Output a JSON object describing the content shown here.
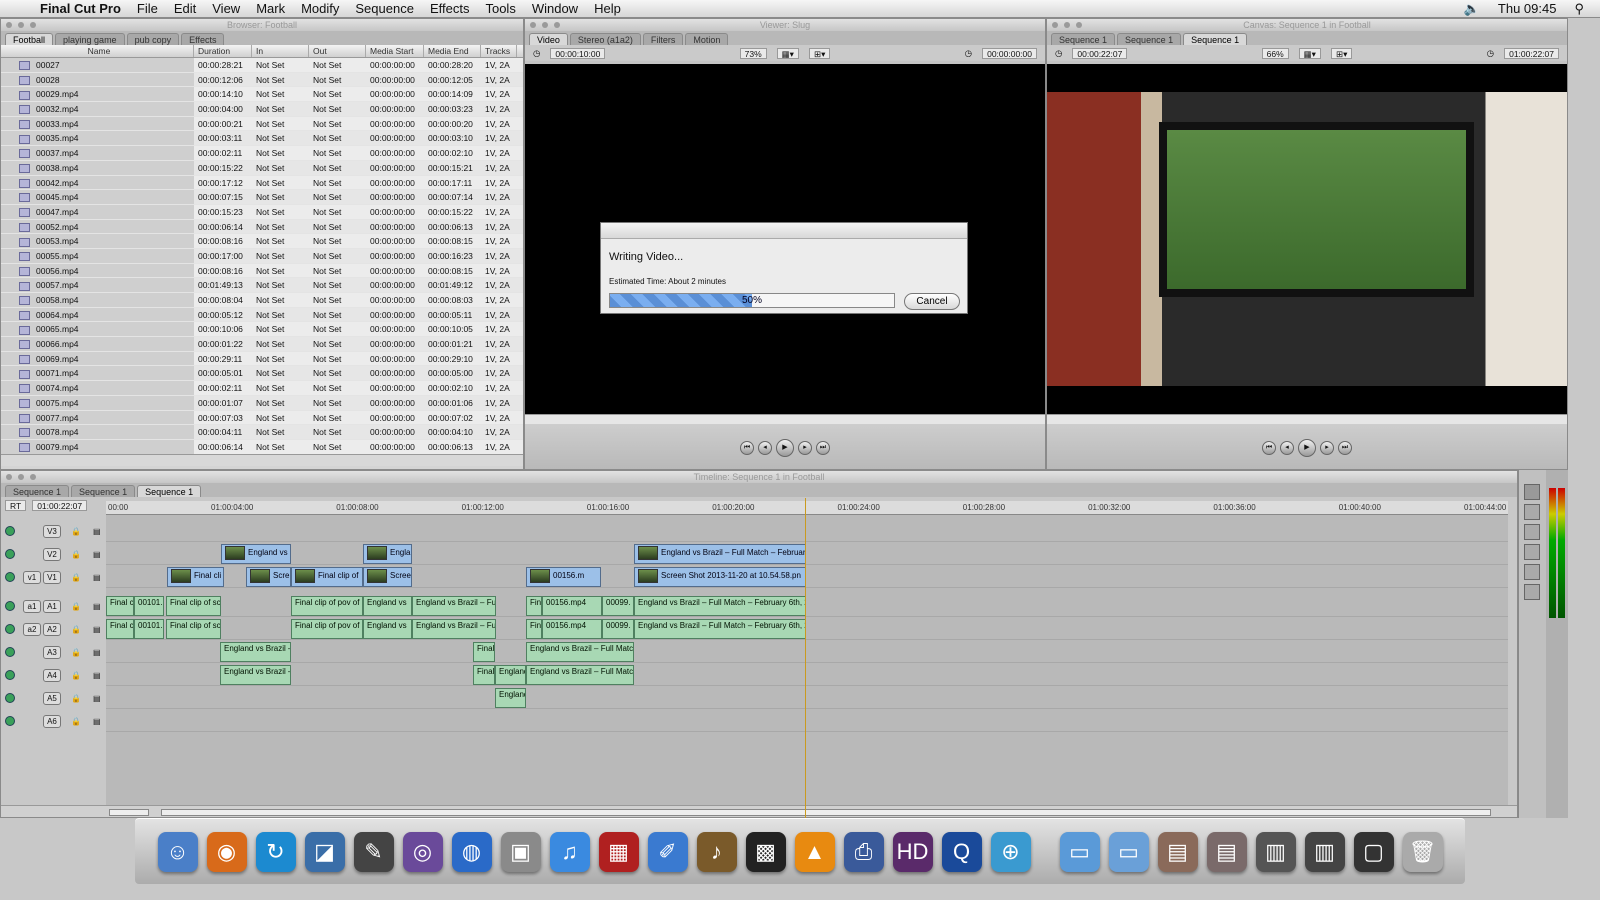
{
  "menubar": {
    "app": "Final Cut Pro",
    "items": [
      "File",
      "Edit",
      "View",
      "Mark",
      "Modify",
      "Sequence",
      "Effects",
      "Tools",
      "Window",
      "Help"
    ],
    "clock": "Thu 09:45"
  },
  "browser": {
    "title": "Browser: Football",
    "tabs": [
      "Football",
      "playing game",
      "pub copy",
      "Effects"
    ],
    "columns": [
      "Name",
      "Duration",
      "In",
      "Out",
      "Media Start",
      "Media End",
      "Tracks"
    ],
    "rows": [
      [
        "00027",
        "00:00:28:21",
        "Not Set",
        "Not Set",
        "00:00:00:00",
        "00:00:28:20",
        "1V, 2A"
      ],
      [
        "00028",
        "00:00:12:06",
        "Not Set",
        "Not Set",
        "00:00:00:00",
        "00:00:12:05",
        "1V, 2A"
      ],
      [
        "00029.mp4",
        "00:00:14:10",
        "Not Set",
        "Not Set",
        "00:00:00:00",
        "00:00:14:09",
        "1V, 2A"
      ],
      [
        "00032.mp4",
        "00:00:04:00",
        "Not Set",
        "Not Set",
        "00:00:00:00",
        "00:00:03:23",
        "1V, 2A"
      ],
      [
        "00033.mp4",
        "00:00:00:21",
        "Not Set",
        "Not Set",
        "00:00:00:00",
        "00:00:00:20",
        "1V, 2A"
      ],
      [
        "00035.mp4",
        "00:00:03:11",
        "Not Set",
        "Not Set",
        "00:00:00:00",
        "00:00:03:10",
        "1V, 2A"
      ],
      [
        "00037.mp4",
        "00:00:02:11",
        "Not Set",
        "Not Set",
        "00:00:00:00",
        "00:00:02:10",
        "1V, 2A"
      ],
      [
        "00038.mp4",
        "00:00:15:22",
        "Not Set",
        "Not Set",
        "00:00:00:00",
        "00:00:15:21",
        "1V, 2A"
      ],
      [
        "00042.mp4",
        "00:00:17:12",
        "Not Set",
        "Not Set",
        "00:00:00:00",
        "00:00:17:11",
        "1V, 2A"
      ],
      [
        "00045.mp4",
        "00:00:07:15",
        "Not Set",
        "Not Set",
        "00:00:00:00",
        "00:00:07:14",
        "1V, 2A"
      ],
      [
        "00047.mp4",
        "00:00:15:23",
        "Not Set",
        "Not Set",
        "00:00:00:00",
        "00:00:15:22",
        "1V, 2A"
      ],
      [
        "00052.mp4",
        "00:00:06:14",
        "Not Set",
        "Not Set",
        "00:00:00:00",
        "00:00:06:13",
        "1V, 2A"
      ],
      [
        "00053.mp4",
        "00:00:08:16",
        "Not Set",
        "Not Set",
        "00:00:00:00",
        "00:00:08:15",
        "1V, 2A"
      ],
      [
        "00055.mp4",
        "00:00:17:00",
        "Not Set",
        "Not Set",
        "00:00:00:00",
        "00:00:16:23",
        "1V, 2A"
      ],
      [
        "00056.mp4",
        "00:00:08:16",
        "Not Set",
        "Not Set",
        "00:00:00:00",
        "00:00:08:15",
        "1V, 2A"
      ],
      [
        "00057.mp4",
        "00:01:49:13",
        "Not Set",
        "Not Set",
        "00:00:00:00",
        "00:01:49:12",
        "1V, 2A"
      ],
      [
        "00058.mp4",
        "00:00:08:04",
        "Not Set",
        "Not Set",
        "00:00:00:00",
        "00:00:08:03",
        "1V, 2A"
      ],
      [
        "00064.mp4",
        "00:00:05:12",
        "Not Set",
        "Not Set",
        "00:00:00:00",
        "00:00:05:11",
        "1V, 2A"
      ],
      [
        "00065.mp4",
        "00:00:10:06",
        "Not Set",
        "Not Set",
        "00:00:00:00",
        "00:00:10:05",
        "1V, 2A"
      ],
      [
        "00066.mp4",
        "00:00:01:22",
        "Not Set",
        "Not Set",
        "00:00:00:00",
        "00:00:01:21",
        "1V, 2A"
      ],
      [
        "00069.mp4",
        "00:00:29:11",
        "Not Set",
        "Not Set",
        "00:00:00:00",
        "00:00:29:10",
        "1V, 2A"
      ],
      [
        "00071.mp4",
        "00:00:05:01",
        "Not Set",
        "Not Set",
        "00:00:00:00",
        "00:00:05:00",
        "1V, 2A"
      ],
      [
        "00074.mp4",
        "00:00:02:11",
        "Not Set",
        "Not Set",
        "00:00:00:00",
        "00:00:02:10",
        "1V, 2A"
      ],
      [
        "00075.mp4",
        "00:00:01:07",
        "Not Set",
        "Not Set",
        "00:00:00:00",
        "00:00:01:06",
        "1V, 2A"
      ],
      [
        "00077.mp4",
        "00:00:07:03",
        "Not Set",
        "Not Set",
        "00:00:00:00",
        "00:00:07:02",
        "1V, 2A"
      ],
      [
        "00078.mp4",
        "00:00:04:11",
        "Not Set",
        "Not Set",
        "00:00:00:00",
        "00:00:04:10",
        "1V, 2A"
      ],
      [
        "00079.mp4",
        "00:00:06:14",
        "Not Set",
        "Not Set",
        "00:00:00:00",
        "00:00:06:13",
        "1V, 2A"
      ]
    ]
  },
  "viewer": {
    "title": "Viewer: Slug",
    "tabs": [
      "Video",
      "Stereo (a1a2)",
      "Filters",
      "Motion"
    ],
    "timecode_left": "00:00:10:00",
    "zoom": "73%",
    "timecode_right": "00:00:00:00"
  },
  "canvas": {
    "title": "Canvas: Sequence 1 in Football",
    "tabs": [
      "Sequence 1",
      "Sequence 1",
      "Sequence 1"
    ],
    "timecode_left": "00:00:22:07",
    "zoom": "66%",
    "timecode_right": "01:00:22:07"
  },
  "dialog": {
    "message": "Writing Video...",
    "estimate": "Estimated Time: About 2 minutes",
    "progress_text": "50%",
    "progress": 0.5,
    "cancel": "Cancel"
  },
  "timeline": {
    "title": "Timeline: Sequence 1 in Football",
    "tabs": [
      "Sequence 1",
      "Sequence 1",
      "Sequence 1"
    ],
    "rt": "RT",
    "timecode": "01:00:22:07",
    "ruler": [
      "00:00",
      "01:00:04:00",
      "01:00:08:00",
      "01:00:12:00",
      "01:00:16:00",
      "01:00:20:00",
      "01:00:24:00",
      "01:00:28:00",
      "01:00:32:00",
      "01:00:36:00",
      "01:00:40:00",
      "01:00:44:00"
    ],
    "tracks": [
      "V3",
      "V2",
      "V1",
      "A1",
      "A2",
      "A3",
      "A4",
      "A5",
      "A6"
    ],
    "src_v": "v1",
    "src_a1": "a1",
    "src_a2": "a2",
    "clips_v2": [
      "England vs B",
      "Engla",
      "England vs Brazil – Full Match – Februar"
    ],
    "clips_v1": [
      "Final cli",
      "Scre",
      "Final clip of",
      "Screen",
      "00156.m",
      "Screen Shot 2013-11-20 at 10.54.58.pn"
    ],
    "clips_a1": [
      "Final c",
      "00101.",
      "Final clip of sc",
      "Final clip of pov of",
      "England vs",
      "England vs Brazil – Fu",
      "Fin",
      "00156.mp4",
      "00099.",
      "England vs Brazil – Full Match – February 6th, 2"
    ],
    "clips_a3": [
      "England vs Brazil –",
      "Final",
      "England vs Brazil – Full Match"
    ],
    "clips_a4": [
      "England vs Brazil –",
      "Final",
      "England",
      "England vs Brazil – Full Match"
    ],
    "clips_a5": [
      "England"
    ]
  },
  "dock": {
    "icons": [
      "finder-icon",
      "firefox-icon",
      "sync-icon",
      "iphoto-icon",
      "final-cut-icon",
      "dvd-studio-icon",
      "dvd-player-icon",
      "preview-icon",
      "itunes-icon",
      "photo-booth-icon",
      "pages-icon",
      "garageband-icon",
      "clapper-icon",
      "vlc-icon",
      "hp-utility-icon",
      "hd-icon",
      "quicktime-icon",
      "safari-icon",
      "applications-folder-icon",
      "documents-folder-icon",
      "stack-icon-1",
      "stack-icon-2",
      "screen-stack-icon",
      "desktop-stack-icon",
      "window-stack-icon",
      "trash-icon"
    ]
  },
  "colors": {
    "video_clip": "#9cc0e8",
    "audio_clip": "#a8d8b4",
    "progress": "#5a8fd6",
    "playhead": "#c99a20"
  }
}
